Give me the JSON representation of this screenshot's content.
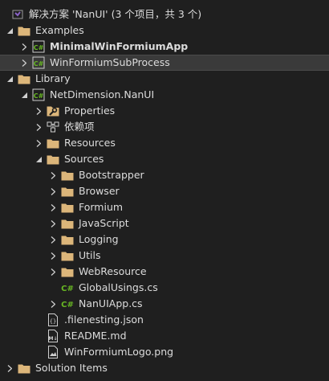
{
  "solution": {
    "label": "解决方案 'NanUI' (3 个项目，共 3 个)"
  },
  "examples": {
    "label": "Examples",
    "projects": [
      "MinimalWinFormiumApp",
      "WinFormiumSubProcess"
    ]
  },
  "library": {
    "label": "Library"
  },
  "project": {
    "label": "NetDimension.NanUI"
  },
  "properties": {
    "label": "Properties"
  },
  "dependencies": {
    "label": "依赖项"
  },
  "resources": {
    "label": "Resources"
  },
  "sources": {
    "label": "Sources",
    "folders": [
      "Bootstrapper",
      "Browser",
      "Formium",
      "JavaScript",
      "Logging",
      "Utils",
      "WebResource"
    ],
    "files": [
      "GlobalUsings.cs",
      "NanUIApp.cs"
    ]
  },
  "root_files": [
    ".filenesting.json",
    "README.md",
    "WinFormiumLogo.png"
  ],
  "solution_items": {
    "label": "Solution Items"
  },
  "colors": {
    "background": "#1f1f1f",
    "folder": "#dcb67a",
    "csharp": "#68b723",
    "selected_row": "#3a3a3a",
    "vs_purple": "#8a62c7"
  }
}
